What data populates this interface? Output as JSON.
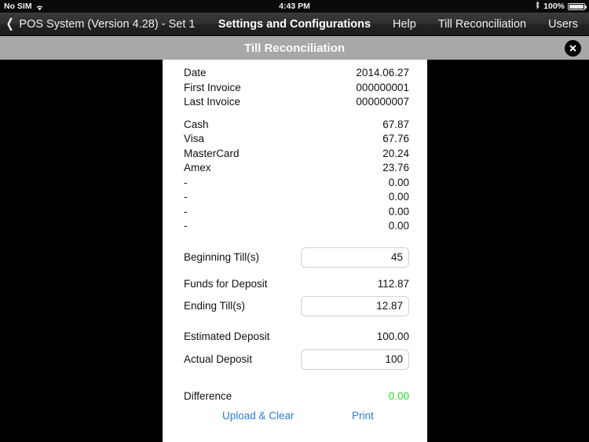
{
  "status_bar": {
    "carrier": "No SIM",
    "wifi_icon": "wifi-icon",
    "time": "4:43 PM",
    "bluetooth_icon": "bluetooth-icon",
    "battery_percent": "100%",
    "battery_icon": "battery-full-icon"
  },
  "nav_bar": {
    "back_icon": "chevron-left-icon",
    "back_label": "POS System (Version 4.28) - Set 1",
    "title": "Settings and Configurations",
    "items": [
      {
        "label": "Help"
      },
      {
        "label": "Till Reconciliation"
      },
      {
        "label": "Users"
      }
    ]
  },
  "modal": {
    "title": "Till Reconciliation",
    "close_icon": "close-circle-icon"
  },
  "report": {
    "header_rows": [
      {
        "label": "Date",
        "value": "2014.06.27"
      },
      {
        "label": "First Invoice",
        "value": "000000001"
      },
      {
        "label": "Last Invoice",
        "value": "000000007"
      }
    ],
    "tender_rows": [
      {
        "label": "Cash",
        "value": "67.87"
      },
      {
        "label": "Visa",
        "value": "67.76"
      },
      {
        "label": "MasterCard",
        "value": "20.24"
      },
      {
        "label": "Amex",
        "value": "23.76"
      },
      {
        "label": "-",
        "value": "0.00"
      },
      {
        "label": "-",
        "value": "0.00"
      },
      {
        "label": "-",
        "value": "0.00"
      },
      {
        "label": "-",
        "value": "0.00"
      }
    ],
    "beginning_till": {
      "label": "Beginning Till(s)",
      "value": "45"
    },
    "funds_for_deposit": {
      "label": "Funds for Deposit",
      "value": "112.87"
    },
    "ending_till": {
      "label": "Ending Till(s)",
      "value": "12.87"
    },
    "estimated_deposit": {
      "label": "Estimated Deposit",
      "value": "100.00"
    },
    "actual_deposit": {
      "label": "Actual Deposit",
      "value": "100"
    },
    "difference": {
      "label": "Difference",
      "value": "0.00",
      "color": "#25e025"
    }
  },
  "actions": {
    "upload_clear": "Upload & Clear",
    "print": "Print"
  }
}
